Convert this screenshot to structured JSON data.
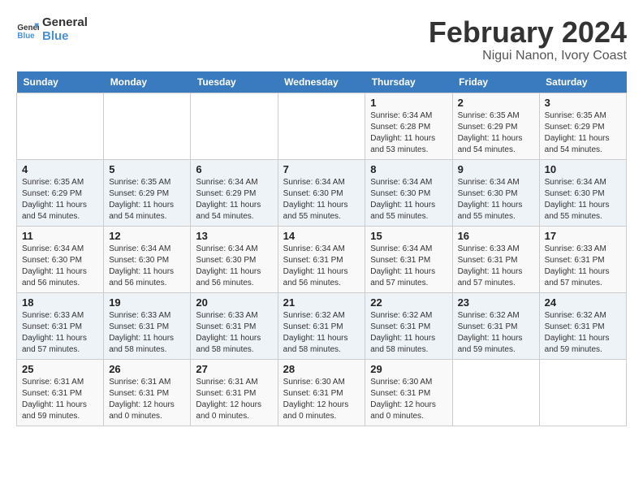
{
  "logo": {
    "line1": "General",
    "line2": "Blue"
  },
  "title": "February 2024",
  "subtitle": "Nigui Nanon, Ivory Coast",
  "weekdays": [
    "Sunday",
    "Monday",
    "Tuesday",
    "Wednesday",
    "Thursday",
    "Friday",
    "Saturday"
  ],
  "weeks": [
    [
      {
        "day": "",
        "detail": ""
      },
      {
        "day": "",
        "detail": ""
      },
      {
        "day": "",
        "detail": ""
      },
      {
        "day": "",
        "detail": ""
      },
      {
        "day": "1",
        "detail": "Sunrise: 6:34 AM\nSunset: 6:28 PM\nDaylight: 11 hours\nand 53 minutes."
      },
      {
        "day": "2",
        "detail": "Sunrise: 6:35 AM\nSunset: 6:29 PM\nDaylight: 11 hours\nand 54 minutes."
      },
      {
        "day": "3",
        "detail": "Sunrise: 6:35 AM\nSunset: 6:29 PM\nDaylight: 11 hours\nand 54 minutes."
      }
    ],
    [
      {
        "day": "4",
        "detail": "Sunrise: 6:35 AM\nSunset: 6:29 PM\nDaylight: 11 hours\nand 54 minutes."
      },
      {
        "day": "5",
        "detail": "Sunrise: 6:35 AM\nSunset: 6:29 PM\nDaylight: 11 hours\nand 54 minutes."
      },
      {
        "day": "6",
        "detail": "Sunrise: 6:34 AM\nSunset: 6:29 PM\nDaylight: 11 hours\nand 54 minutes."
      },
      {
        "day": "7",
        "detail": "Sunrise: 6:34 AM\nSunset: 6:30 PM\nDaylight: 11 hours\nand 55 minutes."
      },
      {
        "day": "8",
        "detail": "Sunrise: 6:34 AM\nSunset: 6:30 PM\nDaylight: 11 hours\nand 55 minutes."
      },
      {
        "day": "9",
        "detail": "Sunrise: 6:34 AM\nSunset: 6:30 PM\nDaylight: 11 hours\nand 55 minutes."
      },
      {
        "day": "10",
        "detail": "Sunrise: 6:34 AM\nSunset: 6:30 PM\nDaylight: 11 hours\nand 55 minutes."
      }
    ],
    [
      {
        "day": "11",
        "detail": "Sunrise: 6:34 AM\nSunset: 6:30 PM\nDaylight: 11 hours\nand 56 minutes."
      },
      {
        "day": "12",
        "detail": "Sunrise: 6:34 AM\nSunset: 6:30 PM\nDaylight: 11 hours\nand 56 minutes."
      },
      {
        "day": "13",
        "detail": "Sunrise: 6:34 AM\nSunset: 6:30 PM\nDaylight: 11 hours\nand 56 minutes."
      },
      {
        "day": "14",
        "detail": "Sunrise: 6:34 AM\nSunset: 6:31 PM\nDaylight: 11 hours\nand 56 minutes."
      },
      {
        "day": "15",
        "detail": "Sunrise: 6:34 AM\nSunset: 6:31 PM\nDaylight: 11 hours\nand 57 minutes."
      },
      {
        "day": "16",
        "detail": "Sunrise: 6:33 AM\nSunset: 6:31 PM\nDaylight: 11 hours\nand 57 minutes."
      },
      {
        "day": "17",
        "detail": "Sunrise: 6:33 AM\nSunset: 6:31 PM\nDaylight: 11 hours\nand 57 minutes."
      }
    ],
    [
      {
        "day": "18",
        "detail": "Sunrise: 6:33 AM\nSunset: 6:31 PM\nDaylight: 11 hours\nand 57 minutes."
      },
      {
        "day": "19",
        "detail": "Sunrise: 6:33 AM\nSunset: 6:31 PM\nDaylight: 11 hours\nand 58 minutes."
      },
      {
        "day": "20",
        "detail": "Sunrise: 6:33 AM\nSunset: 6:31 PM\nDaylight: 11 hours\nand 58 minutes."
      },
      {
        "day": "21",
        "detail": "Sunrise: 6:32 AM\nSunset: 6:31 PM\nDaylight: 11 hours\nand 58 minutes."
      },
      {
        "day": "22",
        "detail": "Sunrise: 6:32 AM\nSunset: 6:31 PM\nDaylight: 11 hours\nand 58 minutes."
      },
      {
        "day": "23",
        "detail": "Sunrise: 6:32 AM\nSunset: 6:31 PM\nDaylight: 11 hours\nand 59 minutes."
      },
      {
        "day": "24",
        "detail": "Sunrise: 6:32 AM\nSunset: 6:31 PM\nDaylight: 11 hours\nand 59 minutes."
      }
    ],
    [
      {
        "day": "25",
        "detail": "Sunrise: 6:31 AM\nSunset: 6:31 PM\nDaylight: 11 hours\nand 59 minutes."
      },
      {
        "day": "26",
        "detail": "Sunrise: 6:31 AM\nSunset: 6:31 PM\nDaylight: 12 hours\nand 0 minutes."
      },
      {
        "day": "27",
        "detail": "Sunrise: 6:31 AM\nSunset: 6:31 PM\nDaylight: 12 hours\nand 0 minutes."
      },
      {
        "day": "28",
        "detail": "Sunrise: 6:30 AM\nSunset: 6:31 PM\nDaylight: 12 hours\nand 0 minutes."
      },
      {
        "day": "29",
        "detail": "Sunrise: 6:30 AM\nSunset: 6:31 PM\nDaylight: 12 hours\nand 0 minutes."
      },
      {
        "day": "",
        "detail": ""
      },
      {
        "day": "",
        "detail": ""
      }
    ]
  ]
}
